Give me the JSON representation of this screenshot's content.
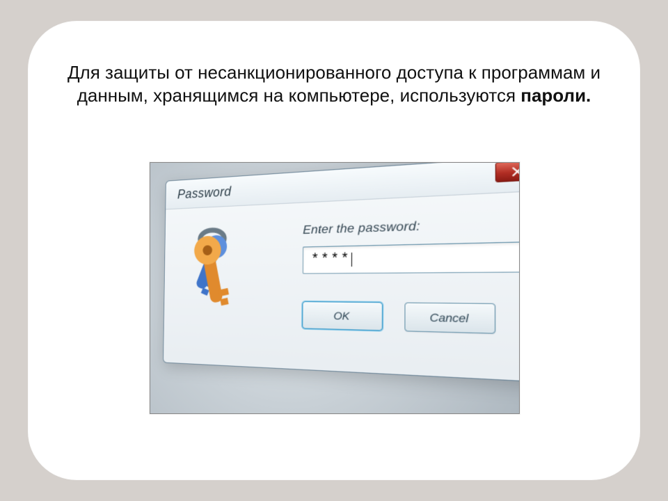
{
  "headline": {
    "text_plain": "Для защиты от несанкционированного доступа к программам и данным, хранящимся на компьютере, используются ",
    "text_bold": "пароли."
  },
  "dialog": {
    "title": "Password",
    "prompt": "Enter the password:",
    "value_masked": "****",
    "buttons": {
      "ok": "OK",
      "cancel": "Cancel"
    }
  }
}
